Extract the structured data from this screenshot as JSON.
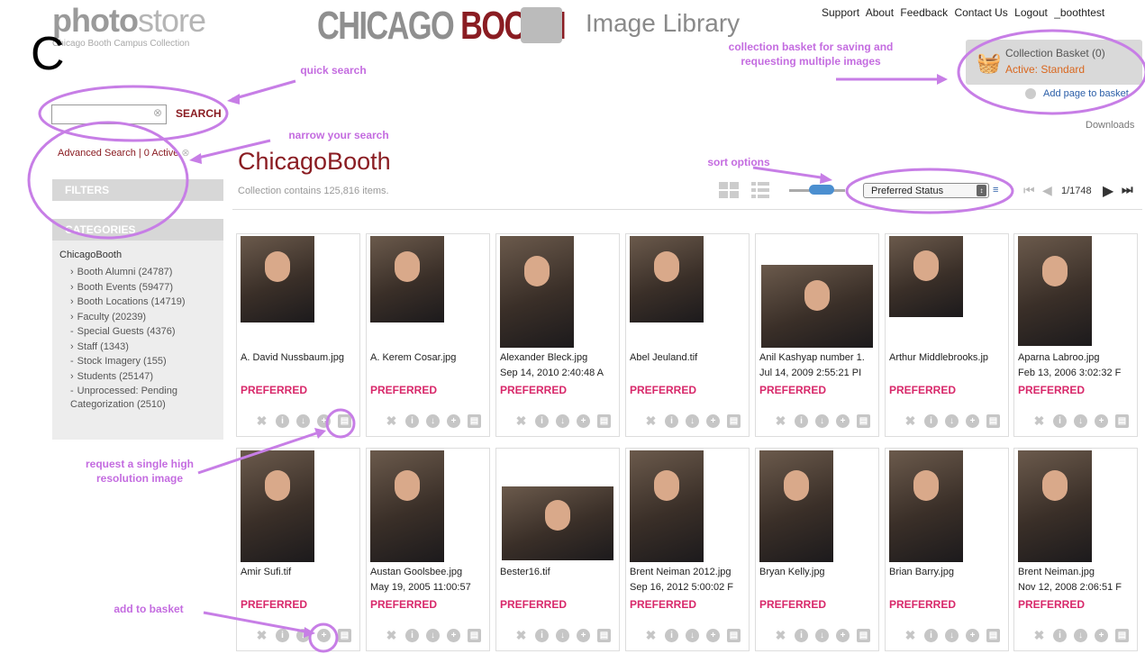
{
  "header": {
    "logo_bold": "photo",
    "logo_light": "store",
    "logo_sub": "Chicago Booth  Campus Collection",
    "brand_a": "CHICAGO ",
    "brand_b": "BOOTH",
    "library_title": "Image Library",
    "big_letter": "C",
    "nav": [
      "Support",
      "About",
      "Feedback",
      "Contact Us",
      "Logout",
      "_boothtest"
    ]
  },
  "basket": {
    "title": "Collection Basket (0)",
    "active": "Active: Standard",
    "add_page": "Add page to basket",
    "downloads": "Downloads"
  },
  "search": {
    "value": "",
    "button": "SEARCH",
    "advanced": "Advanced Search | 0 Active"
  },
  "filters": {
    "label": "FILTERS"
  },
  "categories": {
    "label": "CATEGORIES",
    "root": "ChicagoBooth",
    "items": [
      {
        "marker": "›",
        "label": "Booth Alumni (24787)"
      },
      {
        "marker": "›",
        "label": "Booth Events (59477)"
      },
      {
        "marker": "›",
        "label": "Booth Locations (14719)"
      },
      {
        "marker": "›",
        "label": "Faculty (20239)"
      },
      {
        "marker": "-",
        "label": "Special Guests (4376)"
      },
      {
        "marker": "›",
        "label": "Staff (1343)"
      },
      {
        "marker": "-",
        "label": "Stock Imagery (155)"
      },
      {
        "marker": "›",
        "label": "Students (25147)"
      },
      {
        "marker": "-",
        "label": "Unprocessed: Pending Categorization (2510)"
      }
    ]
  },
  "collection": {
    "title": "ChicagoBooth",
    "count": "Collection contains 125,816 items.",
    "sort": "Preferred Status",
    "page": "1/1748"
  },
  "colors": {
    "maroon": "#8a1c22",
    "preferred": "#d8286a",
    "annotation": "#c46ce0",
    "accent_blue": "#4b8fd0"
  },
  "icons": [
    "zoom-icon",
    "info-icon",
    "download-icon",
    "add-icon",
    "request-icon"
  ],
  "cards": [
    {
      "name": "A. David Nussbaum.jpg",
      "date": "",
      "status": "PREFERRED"
    },
    {
      "name": "A. Kerem Cosar.jpg",
      "date": "",
      "status": "PREFERRED"
    },
    {
      "name": "Alexander Bleck.jpg",
      "date": "Sep 14, 2010 2:40:48 A",
      "status": "PREFERRED"
    },
    {
      "name": "Abel Jeuland.tif",
      "date": "",
      "status": "PREFERRED"
    },
    {
      "name": "Anil Kashyap number 1.",
      "date": "Jul 14, 2009 2:55:21 PI",
      "status": "PREFERRED"
    },
    {
      "name": "Arthur Middlebrooks.jp",
      "date": "",
      "status": "PREFERRED"
    },
    {
      "name": "Aparna Labroo.jpg",
      "date": "Feb 13, 2006 3:02:32 F",
      "status": "PREFERRED"
    },
    {
      "name": "Amir Sufi.tif",
      "date": "",
      "status": "PREFERRED"
    },
    {
      "name": "Austan Goolsbee.jpg",
      "date": "May 19, 2005 11:00:57",
      "status": "PREFERRED"
    },
    {
      "name": "Bester16.tif",
      "date": "",
      "status": "PREFERRED"
    },
    {
      "name": "Brent Neiman 2012.jpg",
      "date": "Sep 16, 2012 5:00:02 F",
      "status": "PREFERRED"
    },
    {
      "name": "Bryan Kelly.jpg",
      "date": "",
      "status": "PREFERRED"
    },
    {
      "name": "Brian Barry.jpg",
      "date": "",
      "status": "PREFERRED"
    },
    {
      "name": "Brent Neiman.jpg",
      "date": "Nov 12, 2008 2:06:51 F",
      "status": "PREFERRED"
    }
  ],
  "annotations": {
    "quick_search": "quick search",
    "narrow": "narrow your search",
    "basket": "collection basket for saving and requesting multiple images",
    "sort": "sort options",
    "request": "request a single high resolution image",
    "add": "add to basket"
  }
}
